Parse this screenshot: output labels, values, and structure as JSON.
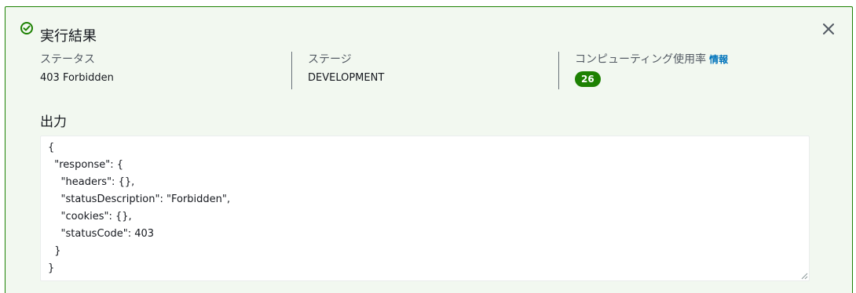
{
  "result": {
    "title": "実行結果",
    "status": {
      "label": "ステータス",
      "value": "403 Forbidden"
    },
    "stage": {
      "label": "ステージ",
      "value": "DEVELOPMENT"
    },
    "compute": {
      "label": "コンピューティング使用率",
      "info_link": "情報",
      "value": "26"
    }
  },
  "output": {
    "label": "出力",
    "lines": [
      "{",
      "  \"response\": {",
      "    \"headers\": {},",
      "    \"statusDescription\": \"Forbidden\",",
      "    \"cookies\": {},",
      "    \"statusCode\": 403",
      "  }",
      "}"
    ]
  },
  "icons": {
    "status": "check-circle-icon",
    "close": "close-icon"
  },
  "colors": {
    "success": "#1d8102",
    "panel_bg": "#f2f8f0",
    "link": "#0073bb"
  }
}
